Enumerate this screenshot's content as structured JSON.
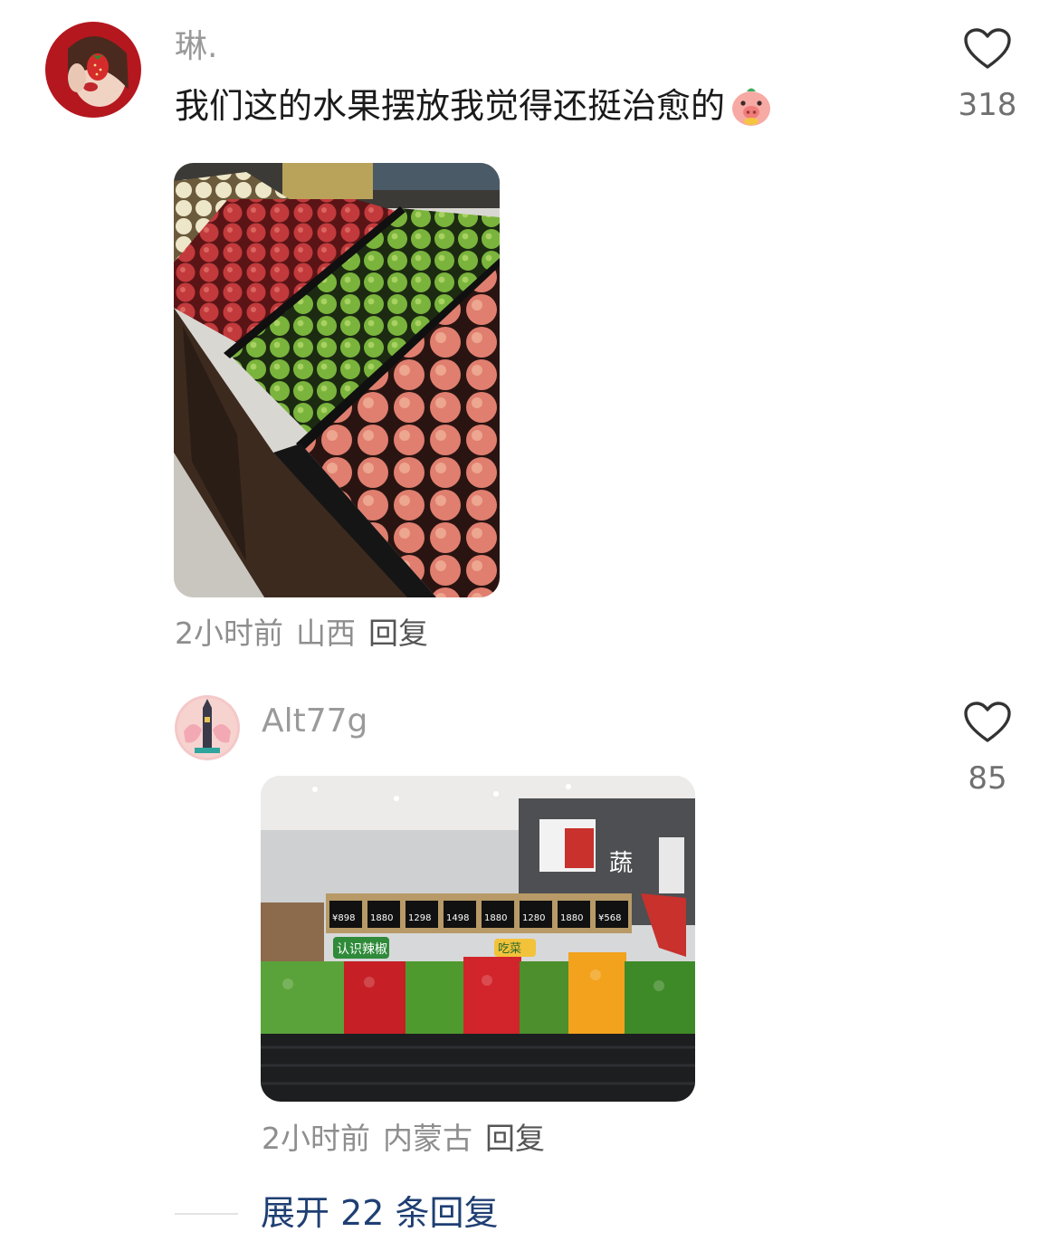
{
  "comments": [
    {
      "username": "琳.",
      "text": "我们这的水果摆放我觉得还挺治愈的",
      "time": "2小时前",
      "location": "山西",
      "reply_label": "回复",
      "likes": "318",
      "photo_icon": "supermarket-apple-display-photo"
    },
    {
      "username": "Alt77g",
      "time": "2小时前",
      "location": "内蒙古",
      "reply_label": "回复",
      "likes": "85",
      "photo_icon": "supermarket-pepper-display-photo",
      "photo_signs": {
        "sign_1": "认识辣椒",
        "sign_2": "吃菜",
        "sign_3": "蔬",
        "prices": [
          "¥898",
          "1880",
          "1298",
          "1498",
          "1880",
          "1280",
          "1880",
          "¥568"
        ]
      }
    }
  ],
  "expand_replies": "展开 22 条回复",
  "colors": {
    "username": "#9a9a9a",
    "body_text": "#1a1a1a",
    "meta_text": "#8e8e8e",
    "expand_link": "#1f3f73",
    "like_outline": "#333333"
  }
}
